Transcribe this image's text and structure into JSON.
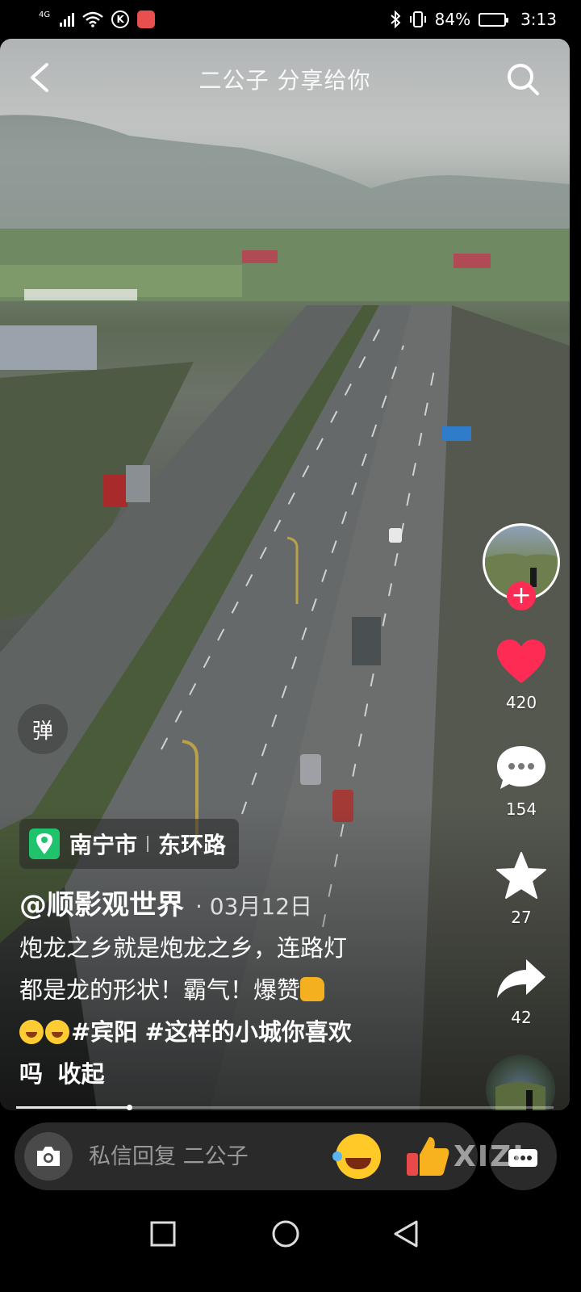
{
  "status_bar": {
    "network": "4G",
    "battery_percent_label": "84%",
    "battery_level": 0.84,
    "time": "3:13",
    "icons": [
      "signal-icon",
      "wifi-icon",
      "k-app-icon",
      "notification-app-icon",
      "bluetooth-icon",
      "vibrate-icon",
      "battery-icon"
    ]
  },
  "header": {
    "title": "二公子 分享给你",
    "icons": [
      "back-arrow-icon",
      "search-icon"
    ]
  },
  "danmu": {
    "label": "弹"
  },
  "right_rail": {
    "likes": "420",
    "comments": "154",
    "favorites": "27",
    "shares": "42",
    "icons": [
      "avatar",
      "plus-icon",
      "heart-icon",
      "comment-icon",
      "star-icon",
      "share-icon",
      "music-disc-icon"
    ],
    "colors": {
      "like": "#fe2c55",
      "follow": "#fe2c55"
    }
  },
  "location": {
    "city": "南宁市",
    "road": "东环路",
    "icon": "location-pin-icon",
    "color": "#1ec36c"
  },
  "post": {
    "author": "@顺影观世界",
    "date": "· 03月12日",
    "caption_line1": "炮龙之乡就是炮龙之乡，连路灯",
    "caption_line2": "都是龙的形状！霸气！爆赞",
    "hashtag1": "#宾阳",
    "hashtag2": "#这样的小城你喜欢",
    "caption_line3_tail": "吗",
    "collapse_label": "收起"
  },
  "progress": {
    "fraction": 0.21
  },
  "reply_bar": {
    "placeholder": "私信回复 二公子",
    "icons": [
      "camera-icon",
      "laughing-emoji-icon",
      "thumbs-up-emoji-icon",
      "more-options-icon"
    ]
  },
  "watermark": "XIZI",
  "nav_bar": {
    "icons": [
      "recent-apps-icon",
      "home-icon",
      "back-triangle-icon"
    ]
  }
}
